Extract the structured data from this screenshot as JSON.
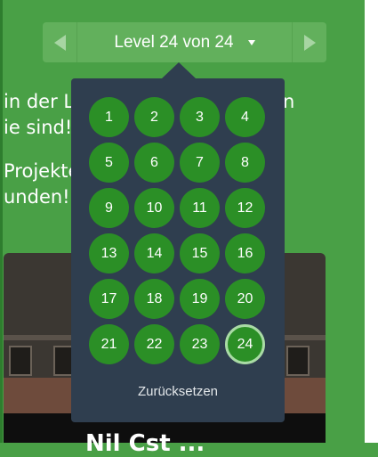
{
  "level_nav": {
    "label": "Level 24 von 24",
    "prev_icon": "chevron-left-icon",
    "next_icon": "chevron-right-icon",
    "dropdown_icon": "caret-down-icon"
  },
  "background_text": {
    "line1": "in der La",
    "line1_right": "n",
    "line2": "ie sind!",
    "line3": "Projekte",
    "line4": "unden!"
  },
  "preview": {
    "title": "Nil Cst ..."
  },
  "level_popover": {
    "levels": [
      "1",
      "2",
      "3",
      "4",
      "5",
      "6",
      "7",
      "8",
      "9",
      "10",
      "11",
      "12",
      "13",
      "14",
      "15",
      "16",
      "17",
      "18",
      "19",
      "20",
      "21",
      "22",
      "23",
      "24"
    ],
    "current_level": "24",
    "reset_label": "Zurücksetzen"
  },
  "colors": {
    "page_bg": "#49a046",
    "level_bar": "#62b05c",
    "popover_bg": "#2f3e4f",
    "level_circle": "#2b8f26",
    "current_ring": "#a9dba5"
  }
}
